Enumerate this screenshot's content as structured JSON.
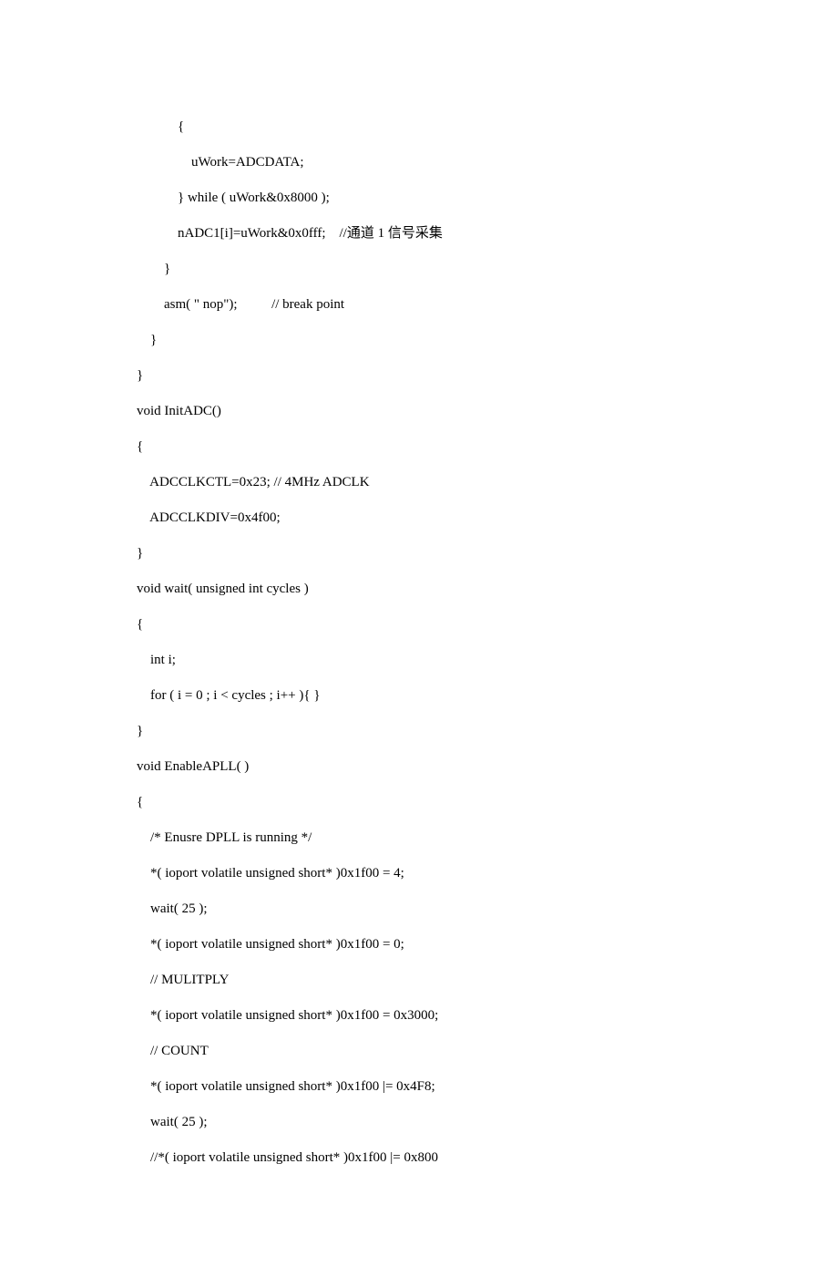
{
  "code": {
    "l1": "            {",
    "l2": "                uWork=ADCDATA;",
    "l3": "            } while ( uWork&0x8000 );",
    "l4a": "            nADC1[i]=uWork&0x0fff;    //",
    "l4b": "通道",
    "l4c": " 1 ",
    "l4d": "信号采集",
    "l5": "        }",
    "l6": "        asm( \" nop\");          // break point",
    "l7": "    }",
    "l8": "}",
    "l9": "void InitADC()",
    "l10": "{",
    "l11": "    ADCCLKCTL=0x23; // 4MHz ADCLK",
    "l12": "    ADCCLKDIV=0x4f00;",
    "l13": "}",
    "l14": "void wait( unsigned int cycles )",
    "l15": "{",
    "l16": "    int i;",
    "l17": "    for ( i = 0 ; i < cycles ; i++ ){ }",
    "l18": "}",
    "l19": "void EnableAPLL( )",
    "l20": "{",
    "l21": "    /* Enusre DPLL is running */",
    "l22": "    *( ioport volatile unsigned short* )0x1f00 = 4;",
    "l23": "    wait( 25 );",
    "l24": "    *( ioport volatile unsigned short* )0x1f00 = 0;",
    "l25": "    // MULITPLY",
    "l26": "    *( ioport volatile unsigned short* )0x1f00 = 0x3000;",
    "l27": "    // COUNT",
    "l28": "    *( ioport volatile unsigned short* )0x1f00 |= 0x4F8;",
    "l29": "    wait( 25 );",
    "l30": "    //*( ioport volatile unsigned short* )0x1f00 |= 0x800"
  }
}
